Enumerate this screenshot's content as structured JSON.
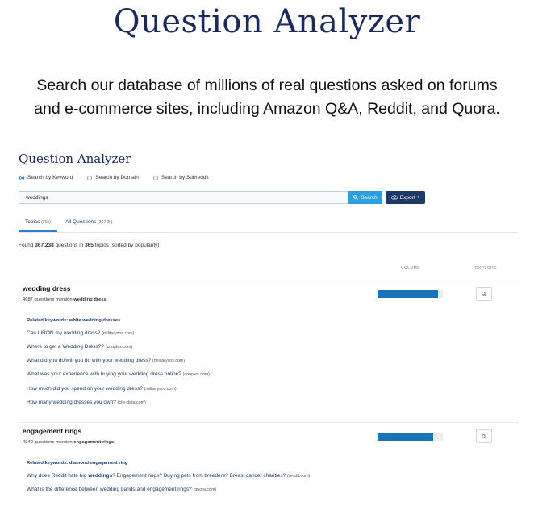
{
  "hero": {
    "title": "Question Analyzer",
    "subtitle_line1": "Search our database of millions of real questions asked on forums",
    "subtitle_line2": "and e-commerce sites, including Amazon Q&A, Reddit, and Quora."
  },
  "app": {
    "title": "Question Analyzer",
    "radios": [
      {
        "label": "Search by Keyword",
        "selected": true
      },
      {
        "label": "Search by Domain",
        "selected": false
      },
      {
        "label": "Search by Subreddit",
        "selected": false
      }
    ],
    "search": {
      "value": "weddings",
      "button_label": "Search"
    },
    "export_label": "Export",
    "tabs": [
      {
        "label": "Topics",
        "count": "(365)",
        "active": true
      },
      {
        "label": "All Questions",
        "count": "(367.2k)",
        "active": false
      }
    ],
    "summary": {
      "prefix": "Found",
      "questions": "367,238",
      "middle": "questions in",
      "topics": "365",
      "suffix": "topics (sorted by popularity)"
    },
    "columns": {
      "volume": "VOLUME",
      "explore": "EXPLORE"
    },
    "topics": [
      {
        "name": "wedding dress",
        "mention_count": "4687",
        "mention_text": "questions mention",
        "mention_term": "wedding dress",
        "volume": 0.92,
        "related_label": "Related keywords: white wedding dresses",
        "questions": [
          {
            "text": "Can I IRON my wedding dress?",
            "source": "(militarysos.com)"
          },
          {
            "text": "Where to get a Wedding Dress??",
            "source": "(couples.com)"
          },
          {
            "text": "What did you do/will you do with your wedding dress?",
            "source": "(militarysos.com)"
          },
          {
            "text": "What was your experience with buying your wedding dress online?",
            "source": "(couples.com)"
          },
          {
            "text": "How much did you spend on your wedding dress?",
            "source": "(militarysos.com)"
          },
          {
            "text": "How many wedding dresses you own?",
            "source": "(city-data.com)"
          }
        ]
      },
      {
        "name": "engagement rings",
        "mention_count": "4340",
        "mention_text": "questions mention",
        "mention_term": "engagement rings",
        "volume": 0.85,
        "related_label": "Related keywords: diamond engagement ring",
        "questions": [
          {
            "text_a": "Why does Reddit hate big",
            "text_bold": "weddings",
            "text_b": "? Engagement rings? Buying pets from breeders? Breast cancer charities?",
            "source": "(reddit.com)"
          },
          {
            "text": "What is the difference between wedding bands and engagement rings?",
            "source": "(quora.com)"
          }
        ]
      }
    ]
  }
}
